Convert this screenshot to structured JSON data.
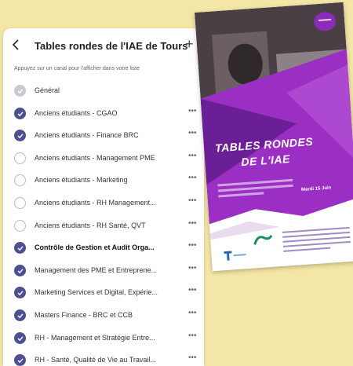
{
  "header": {
    "title": "Tables rondes de l'IAE de Tours",
    "hint": "Appuyez sur un canal pour l'afficher dans votre liste",
    "more_glyph": "•••"
  },
  "channels": [
    {
      "label": "Général",
      "state": "disabled",
      "bold": false,
      "more": false
    },
    {
      "label": "Anciens étudiants - CGAO",
      "state": "on",
      "bold": false,
      "more": true
    },
    {
      "label": "Anciens étudiants - Finance BRC",
      "state": "on",
      "bold": false,
      "more": true
    },
    {
      "label": "Anciens étudiants - Management PME",
      "state": "off",
      "bold": false,
      "more": true
    },
    {
      "label": "Anciens étudiants - Marketing",
      "state": "off",
      "bold": false,
      "more": true
    },
    {
      "label": "Anciens étudiants - RH Management...",
      "state": "off",
      "bold": false,
      "more": true
    },
    {
      "label": "Anciens étudiants - RH Santé, QVT",
      "state": "off",
      "bold": false,
      "more": true
    },
    {
      "label": "Contrôle de Gestion et Audit Orga...",
      "state": "on",
      "bold": true,
      "more": true
    },
    {
      "label": "Management des PME et Entreprene...",
      "state": "on",
      "bold": false,
      "more": true
    },
    {
      "label": "Marketing Services et Digital, Expérie...",
      "state": "on",
      "bold": false,
      "more": true
    },
    {
      "label": "Masters Finance - BRC et CCB",
      "state": "on",
      "bold": false,
      "more": true
    },
    {
      "label": "RH - Management et Stratégie Entre...",
      "state": "on",
      "bold": false,
      "more": true
    },
    {
      "label": "RH - Santé, Qualité de Vie au Travail...",
      "state": "on",
      "bold": false,
      "more": true
    }
  ],
  "poster": {
    "title_line1": "TABLES RONDES",
    "title_line2": "DE L'IAE",
    "date": "Mardi 15 Juin",
    "colors": {
      "purple": "#9b2fc4",
      "dark_purple": "#6a1f96",
      "photo": "#4a3f44"
    }
  },
  "colors": {
    "accent": "#4e4e93",
    "background": "#f4e6a6"
  }
}
